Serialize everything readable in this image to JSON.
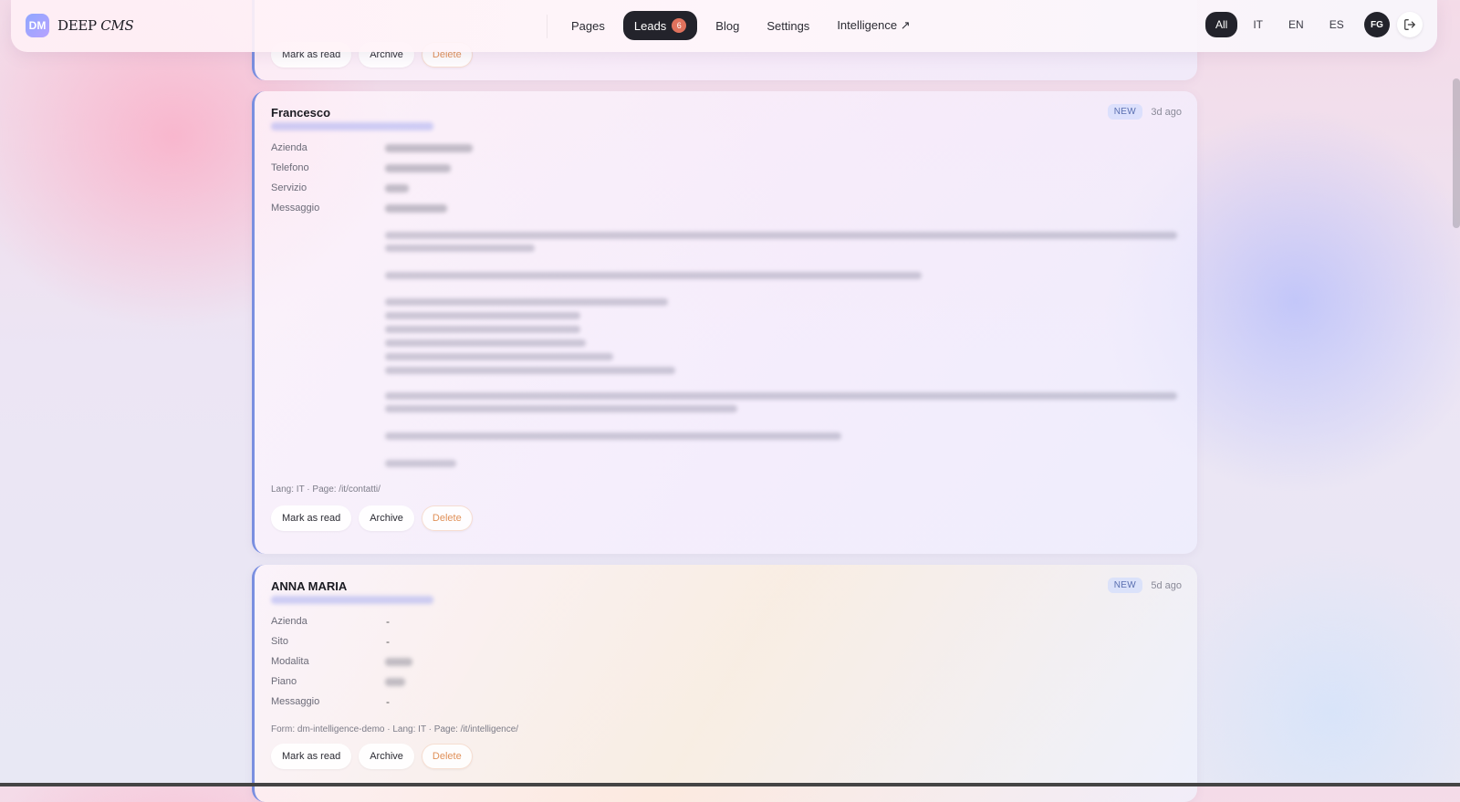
{
  "brand": {
    "logo": "DM",
    "name_main": "DEEP",
    "name_italic": "CMS"
  },
  "nav": {
    "items": [
      {
        "label": "Pages"
      },
      {
        "label": "Leads",
        "badge": "6"
      },
      {
        "label": "Blog"
      },
      {
        "label": "Settings"
      },
      {
        "label": "Intelligence ↗"
      }
    ]
  },
  "languages": [
    "All",
    "IT",
    "EN",
    "ES"
  ],
  "user": {
    "initials": "FG"
  },
  "actions": {
    "mark_read": "Mark as read",
    "archive": "Archive",
    "delete": "Delete"
  },
  "leads": [
    {
      "name": "Francesco",
      "status": "NEW",
      "time": "3d ago",
      "fields": [
        "Azienda",
        "Telefono",
        "Servizio",
        "Messaggio"
      ],
      "meta": "Lang: IT · Page: /it/contatti/"
    },
    {
      "name": "ANNA MARIA",
      "status": "NEW",
      "time": "5d ago",
      "fields": [
        "Azienda",
        "Sito",
        "Modalita",
        "Piano",
        "Messaggio"
      ],
      "values": [
        "-",
        "-",
        "",
        "",
        "-"
      ],
      "meta": "Form: dm-intelligence-demo · Lang: IT · Page: /it/intelligence/"
    }
  ],
  "colors": {
    "accent": "#23232b",
    "badge": "#e0725d",
    "delete": "#e0915a",
    "status": "#5a6fb0"
  }
}
